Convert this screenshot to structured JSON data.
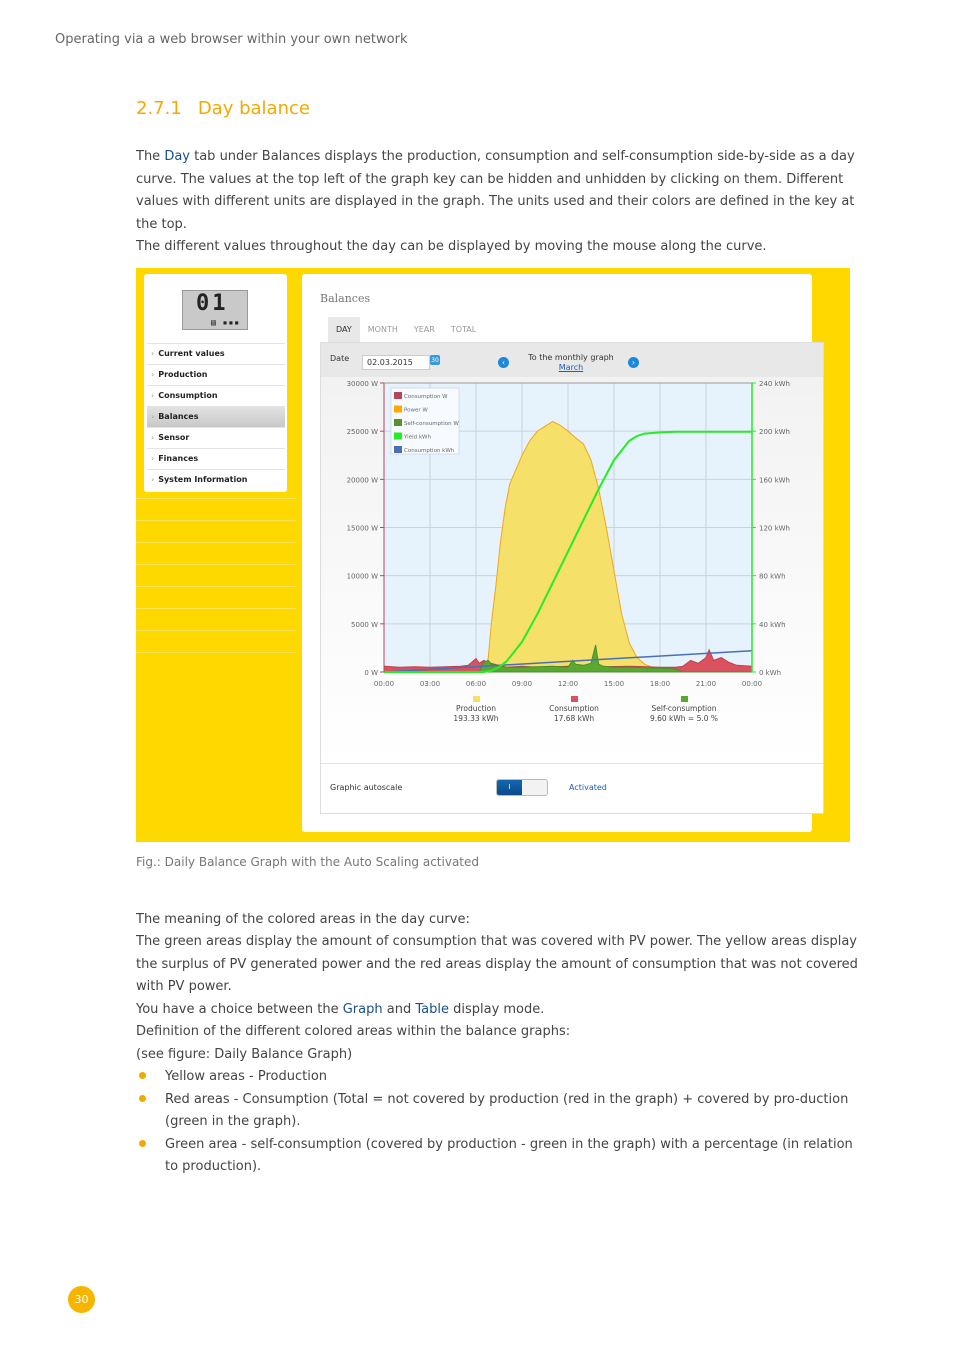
{
  "running_head": "Operating via a web browser within your own network",
  "section": {
    "number": "2.7.1",
    "title": "Day balance"
  },
  "intro": {
    "p1_pre": "The ",
    "p1_link": "Day",
    "p1_post": " tab under Balances displays the production, consumption and self-consumption side-by-side as a day curve. The values at the top left of the graph key can be hidden and unhidden by clicking on them. Different values with different units are displayed in the graph. The units used and their colors are defined in the key at the top.",
    "p2": "The different values throughout the day can be displayed by moving the mouse along the curve."
  },
  "figure": {
    "lcd": {
      "digits": "01",
      "icons": "▤ ▪▪▪"
    },
    "sidebar": {
      "items": [
        {
          "label": "Current values",
          "active": false
        },
        {
          "label": "Production",
          "active": false
        },
        {
          "label": "Consumption",
          "active": false
        },
        {
          "label": "Balances",
          "active": true
        },
        {
          "label": "Sensor",
          "active": false
        },
        {
          "label": "Finances",
          "active": false
        },
        {
          "label": "System Information",
          "active": false
        }
      ],
      "chevron": "›"
    },
    "panel_title": "Balances",
    "tabs": [
      {
        "label": "DAY",
        "active": true
      },
      {
        "label": "MONTH",
        "active": false
      },
      {
        "label": "YEAR",
        "active": false
      },
      {
        "label": "TOTAL",
        "active": false
      }
    ],
    "date": {
      "label": "Date",
      "value": "02.03.2015",
      "calendar_icon": "30"
    },
    "monthly_link": {
      "text": "To the monthly graph",
      "month": "March",
      "prev_icon": "‹",
      "next_icon": "›"
    },
    "summary": [
      {
        "label": "Production",
        "value": "193.33 kWh",
        "color": "#f5e06a"
      },
      {
        "label": "Consumption",
        "value": "17.68 kWh",
        "color": "#d9525e"
      },
      {
        "label": "Self-consumption",
        "value": "9.60 kWh = 5.0 %",
        "color": "#5aa832"
      }
    ],
    "autoscale": {
      "label": "Graphic autoscale",
      "toggle_on_text": "I",
      "state": "Activated"
    }
  },
  "chart_data": {
    "type": "area",
    "title": "",
    "x_ticks": [
      "00:00",
      "03:00",
      "06:00",
      "09:00",
      "12:00",
      "15:00",
      "18:00",
      "21:00",
      "00:00"
    ],
    "x_range_hours": [
      0,
      24
    ],
    "y_left": {
      "ticks": [
        "0 W",
        "5000 W",
        "10000 W",
        "15000 W",
        "20000 W",
        "25000 W",
        "30000 W"
      ],
      "range": [
        0,
        30000
      ],
      "unit": "W"
    },
    "y_right": {
      "ticks": [
        "0 kWh",
        "40 kWh",
        "80 kWh",
        "120 kWh",
        "160 kWh",
        "200 kWh",
        "240 kWh"
      ],
      "range": [
        0,
        240
      ],
      "unit": "kWh"
    },
    "grid": true,
    "legend_position": "top-left",
    "legend": [
      {
        "name": "Consumption W",
        "color": "#b5475a"
      },
      {
        "name": "Power W",
        "color": "#ffa800"
      },
      {
        "name": "Self-consumption W",
        "color": "#5a8f29"
      },
      {
        "name": "Yield kWh",
        "color": "#22ee22"
      },
      {
        "name": "Consumption kWh",
        "color": "#4a6fb5"
      }
    ],
    "series": [
      {
        "name": "Power W",
        "axis": "left",
        "x": [
          0,
          6.5,
          6.8,
          7.0,
          7.3,
          7.6,
          7.9,
          8.2,
          8.6,
          9.0,
          9.5,
          10.0,
          10.5,
          11.0,
          11.5,
          12.0,
          12.5,
          13.0,
          13.5,
          14.0,
          14.5,
          15.0,
          15.5,
          16.0,
          16.5,
          17.0,
          17.5,
          18.0,
          18.5,
          19.0,
          19.5,
          24
        ],
        "y": [
          0,
          0,
          1500,
          5000,
          9000,
          13500,
          17000,
          19500,
          21000,
          22500,
          24000,
          25000,
          25500,
          26000,
          25600,
          25000,
          24300,
          23700,
          22000,
          19000,
          15000,
          10500,
          6000,
          3000,
          1500,
          800,
          500,
          400,
          300,
          150,
          0,
          0
        ]
      },
      {
        "name": "Consumption W",
        "axis": "left",
        "x": [
          0,
          1,
          2,
          3,
          4,
          5,
          5.5,
          6.0,
          6.2,
          6.5,
          7,
          8,
          9,
          10,
          12,
          14,
          16,
          18,
          19,
          19.5,
          20,
          20.5,
          21,
          21.2,
          21.5,
          22,
          22.5,
          23,
          24
        ],
        "y": [
          600,
          500,
          550,
          500,
          550,
          600,
          700,
          1400,
          900,
          1200,
          900,
          500,
          600,
          500,
          600,
          550,
          600,
          500,
          500,
          600,
          1200,
          900,
          1500,
          2300,
          1200,
          1500,
          1000,
          700,
          600
        ]
      },
      {
        "name": "Self-consumption W",
        "axis": "left",
        "x": [
          0,
          6.2,
          6.5,
          6.8,
          7.0,
          7.5,
          8,
          9,
          10,
          11,
          12,
          12.3,
          12.5,
          13,
          13.5,
          13.8,
          14.0,
          14.3,
          15,
          16,
          17,
          18,
          19,
          19.5,
          24
        ],
        "y": [
          0,
          0,
          1000,
          1200,
          800,
          600,
          500,
          500,
          550,
          600,
          500,
          1200,
          800,
          700,
          900,
          2800,
          800,
          600,
          500,
          500,
          450,
          400,
          300,
          0,
          0
        ]
      },
      {
        "name": "Yield kWh",
        "axis": "right",
        "x": [
          0,
          6.5,
          7,
          7.5,
          8,
          9,
          10,
          11,
          12,
          13,
          14,
          15,
          16,
          16.5,
          17,
          18,
          19,
          24
        ],
        "y": [
          0,
          0,
          1,
          4,
          9,
          25,
          48,
          74,
          100,
          126,
          152,
          176,
          192,
          196,
          198,
          199,
          199.5,
          199.5
        ]
      },
      {
        "name": "Consumption kWh",
        "axis": "right",
        "x": [
          0,
          24
        ],
        "y": [
          0,
          17.68
        ]
      }
    ],
    "totals": [
      {
        "name": "Production",
        "value": "193.33 kWh"
      },
      {
        "name": "Consumption",
        "value": "17.68 kWh"
      },
      {
        "name": "Self-consumption",
        "value": "9.60 kWh = 5.0 %"
      }
    ]
  },
  "caption": "Fig.: Daily Balance Graph with the Auto Scaling activated",
  "body": {
    "l1": "The meaning of the colored areas in the day curve:",
    "l2": "The green areas display the amount of consumption that was covered with PV power. The yellow areas display the surplus of PV generated power and the red areas display the amount of consumption that was not covered with PV power.",
    "l3_pre": "You have a choice between the ",
    "l3_link1": "Graph",
    "l3_mid": " and ",
    "l3_link2": "Table",
    "l3_post": " display mode.",
    "l4": "Definition of the different colored areas within the balance graphs:",
    "l5": "(see figure: Daily Balance Graph)"
  },
  "bullets": [
    "Yellow areas - Production",
    "Red areas -  Consumption (Total = not covered by production (red in the graph) + covered by pro-duction (green in the graph).",
    "Green area - self-consumption (covered by production - green in the graph) with a percentage (in relation to production)."
  ],
  "page_number": "30"
}
